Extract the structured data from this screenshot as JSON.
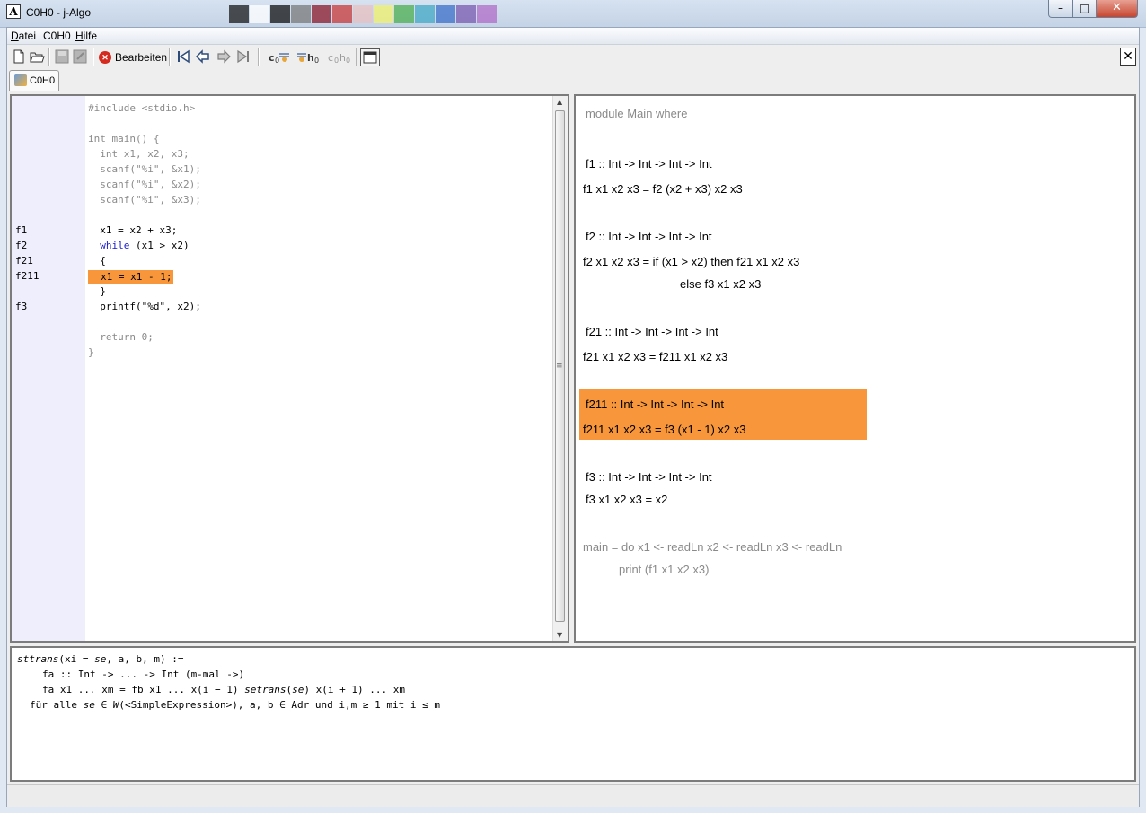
{
  "window": {
    "title": "C0H0  - j-Algo"
  },
  "title_swatches": [
    "#1a1a1a",
    "#ffffff",
    "#111111",
    "#7a7a7a",
    "#8b1a2b",
    "#c83a3a",
    "#e8c0c0",
    "#f2f26a",
    "#4caf50",
    "#41a8c6",
    "#3b6fc8",
    "#7a5ab0",
    "#b06cc8"
  ],
  "menu": {
    "items": [
      "Datei",
      "C0H0",
      "Hilfe"
    ]
  },
  "toolbar": {
    "edit_label": "Bearbeiten"
  },
  "tabs": [
    {
      "label": "C0H0"
    }
  ],
  "code_pane": {
    "gutter": [
      "f1",
      "f2",
      "f21",
      "f211",
      "f3"
    ],
    "lines": [
      "#include <stdio.h>",
      "int main() {",
      "  int x1, x2, x3;",
      "  scanf(\"%i\", &x1);",
      "  scanf(\"%i\", &x2);",
      "  scanf(\"%i\", &x3);",
      "  x1 = x2 + x3;",
      "while",
      " (x1 > x2)",
      "  {",
      "x1 = x1 - 1;",
      "  }",
      "  printf(\"%d\", x2);",
      "  return 0;",
      "}"
    ],
    "indent": "  ",
    "highlight_color": "#f7963a"
  },
  "haskell_pane": {
    "lines": [
      "module Main where",
      "f1 :: Int -> Int -> Int -> Int",
      "f1 x1 x2 x3 = f2 (x2 + x3) x2 x3",
      "f2 :: Int -> Int -> Int -> Int",
      "f2 x1 x2 x3 = if (x1 > x2) then f21 x1 x2 x3",
      "else f3 x1 x2 x3",
      "f21 :: Int -> Int -> Int -> Int",
      "f21 x1 x2 x3 = f211 x1 x2 x3",
      "f211 :: Int -> Int -> Int -> Int",
      "f211 x1 x2 x3 = f3 (x1 - 1) x2 x3",
      "f3 :: Int -> Int -> Int -> Int",
      "f3 x1 x2 x3 = x2",
      "main = do x1 <- readLn x2 <- readLn x3 <- readLn",
      "print (f1 x1 x2 x3)"
    ]
  },
  "rule_pane": {
    "l1_a": "sttrans",
    "l1_b": "(xi = ",
    "l1_c": "se",
    "l1_d": ", a, b, m) :=",
    "l2": "fa :: Int -> ... -> Int (m-mal ->)",
    "l3_a": "fa x1 ... xm = fb x1 ... x(i − 1) ",
    "l3_b": "setrans",
    "l3_c": "(",
    "l3_d": "se",
    "l3_e": ") x(i + 1) ... xm",
    "l4_a": "für alle ",
    "l4_b": "se",
    "l4_c": " ∈ ",
    "l4_d": "W",
    "l4_e": "(<SimpleExpression>), a, b ∈ Adr und i,m ≥ 1 mit i ≤ m"
  }
}
